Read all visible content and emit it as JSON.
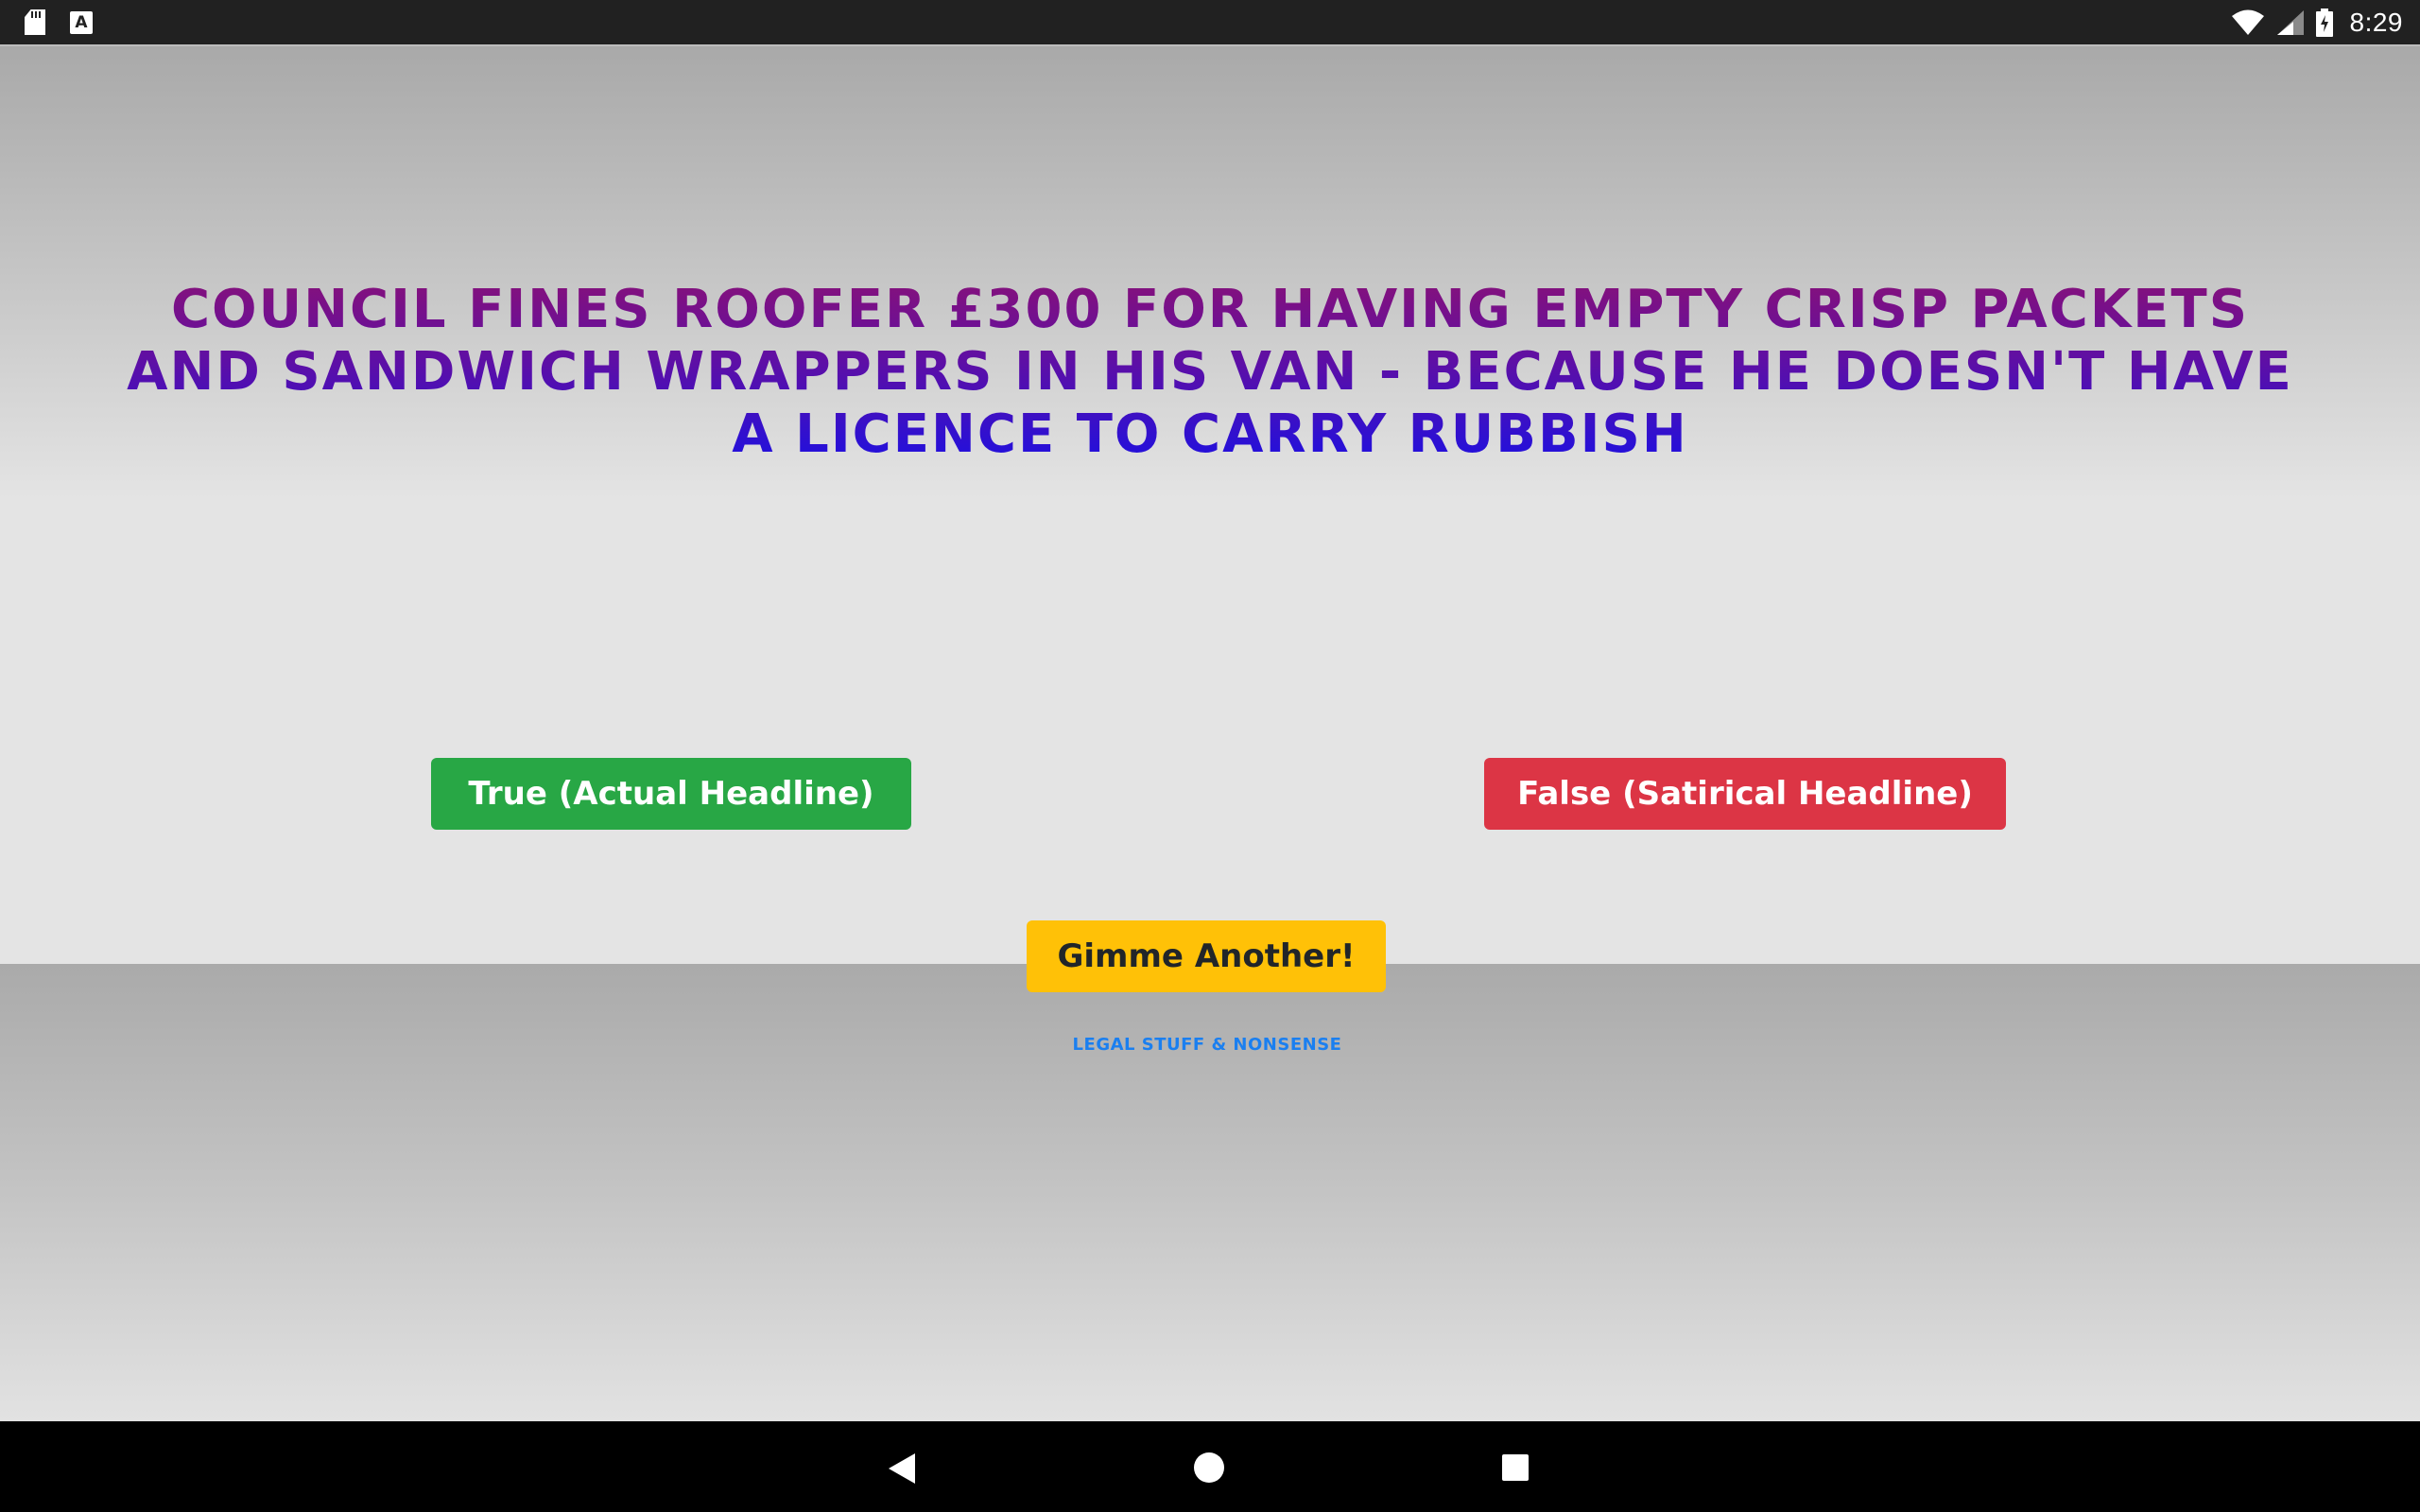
{
  "status_bar": {
    "time": "8:29",
    "a_icon_label": "A",
    "icons": [
      "sd-card-icon",
      "a-notification-icon",
      "wifi-icon",
      "signal-icon",
      "battery-charging-icon"
    ]
  },
  "quiz": {
    "headline": "COUNCIL FINES ROOFER £300 FOR HAVING EMPTY CRISP PACKETS AND SANDWICH WRAPPERS IN HIS VAN - BECAUSE HE DOESN'T HAVE A LICENCE TO CARRY RUBBISH",
    "true_button_label": "True (Actual Headline)",
    "false_button_label": "False (Satirical Headline)",
    "another_button_label": "Gimme Another!",
    "legal_link_label": "LEGAL STUFF & NONSENSE"
  },
  "navigation_bar": {
    "buttons": [
      "back-icon",
      "home-icon",
      "recents-icon"
    ]
  },
  "colors": {
    "true_button": "#28a745",
    "false_button": "#dc3545",
    "another_button": "#ffc107",
    "legal_link": "#1a7ff0",
    "headline_gradient_top": "#86117a",
    "headline_gradient_bottom": "#1e10e0"
  }
}
